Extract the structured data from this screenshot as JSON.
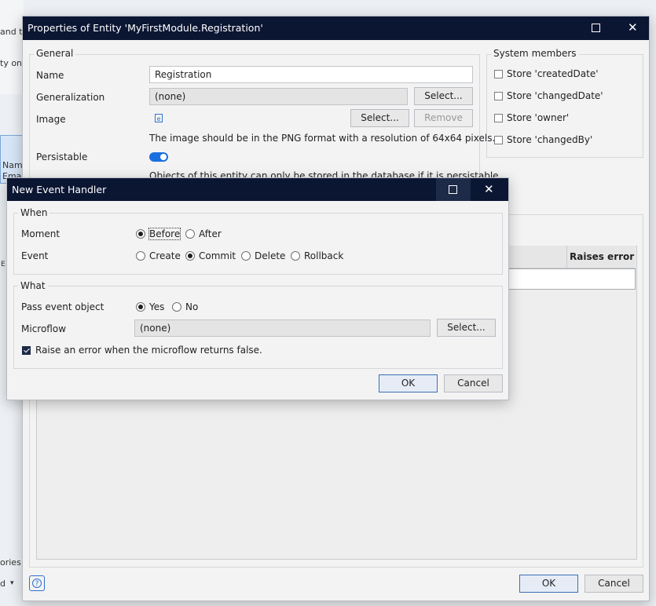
{
  "background": {
    "frag_top": "and th",
    "frag_mid": "ty on",
    "frag_name": "Nam",
    "frag_email": "Emai",
    "frag_e": "E",
    "frag_ories": "ories",
    "frag_d": "d"
  },
  "properties_dialog": {
    "title": "Properties of Entity 'MyFirstModule.Registration'",
    "general": {
      "legend": "General",
      "name_label": "Name",
      "name_value": "Registration",
      "generalization_label": "Generalization",
      "generalization_value": "(none)",
      "generalization_select": "Select...",
      "image_label": "Image",
      "image_select": "Select...",
      "image_remove": "Remove",
      "image_hint": "The image should be in the PNG format with a resolution of 64x64 pixels.",
      "persistable_label": "Persistable",
      "persistable_on": true,
      "persistable_hint": "Objects of this entity can only be stored in the database if it is persistable"
    },
    "system_members": {
      "legend": "System members",
      "items": [
        {
          "label": "Store 'createdDate'",
          "checked": false
        },
        {
          "label": "Store 'changedDate'",
          "checked": false
        },
        {
          "label": "Store 'owner'",
          "checked": false
        },
        {
          "label": "Store 'changedBy'",
          "checked": false
        }
      ]
    },
    "table": {
      "col_raises_error": "Raises error"
    },
    "ok": "OK",
    "cancel": "Cancel"
  },
  "event_dialog": {
    "title": "New Event Handler",
    "when": {
      "legend": "When",
      "moment_label": "Moment",
      "moment_options": [
        "Before",
        "After"
      ],
      "moment_selected": "Before",
      "event_label": "Event",
      "event_options": [
        "Create",
        "Commit",
        "Delete",
        "Rollback"
      ],
      "event_selected": "Commit"
    },
    "what": {
      "legend": "What",
      "pass_label": "Pass event object",
      "pass_options": [
        "Yes",
        "No"
      ],
      "pass_selected": "Yes",
      "microflow_label": "Microflow",
      "microflow_value": "(none)",
      "microflow_select": "Select...",
      "raise_error_label": "Raise an error when the microflow returns false.",
      "raise_error_checked": true
    },
    "ok": "OK",
    "cancel": "Cancel"
  },
  "colors": {
    "titlebar": "#0b1633",
    "accent": "#1a6fe0"
  }
}
